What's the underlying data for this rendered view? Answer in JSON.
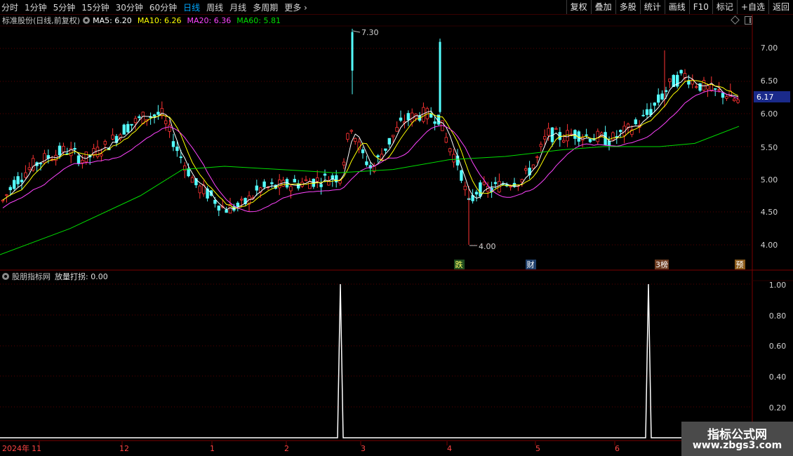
{
  "toolbar": {
    "left_items": [
      "分时",
      "1分钟",
      "5分钟",
      "15分钟",
      "30分钟",
      "60分钟",
      "日线",
      "周线",
      "月线",
      "多周期",
      "更多"
    ],
    "active": "日线",
    "right_items": [
      "复权",
      "叠加",
      "多股",
      "统计",
      "画线",
      "F10",
      "标记",
      "+自选",
      "返回"
    ]
  },
  "main_header": {
    "title": "标准股份(日线,前复权)",
    "ma": [
      {
        "label": "MA5: 6.20",
        "color": "#ffffff"
      },
      {
        "label": "MA10: 6.26",
        "color": "#ffff00"
      },
      {
        "label": "MA20: 6.36",
        "color": "#ff44ff"
      },
      {
        "label": "MA60: 5.81",
        "color": "#00dd00"
      }
    ]
  },
  "price_axis": {
    "labels": [
      "7.00",
      "6.50",
      "6.00",
      "5.50",
      "5.00",
      "4.50",
      "4.00"
    ],
    "current": "6.17"
  },
  "annotations": {
    "high": "7.30",
    "low": "4.00"
  },
  "event_markers": [
    {
      "label": "跌",
      "bg": "#1f4d1f",
      "color": "#ffff66"
    },
    {
      "label": "财",
      "bg": "#1f3f6b",
      "color": "#ffffff"
    },
    {
      "label": "3榜",
      "bg": "#6b3a1f",
      "color": "#ffffff"
    },
    {
      "label": "预",
      "bg": "#8a5a1a",
      "color": "#ffffff"
    }
  ],
  "sub_header": {
    "title": "股朋指标网",
    "indicator": "放量打拐: 0.00"
  },
  "indicator_axis": {
    "labels": [
      "1.00",
      "0.80",
      "0.60",
      "0.40",
      "0.20"
    ]
  },
  "timeline": {
    "labels": [
      "2024年",
      "11",
      "12",
      "1",
      "2",
      "3",
      "4",
      "5",
      "6"
    ]
  },
  "watermark": {
    "line1": "指标公式网",
    "line2": "www.zbgs3.com"
  },
  "colors": {
    "up": "#ff3333",
    "down": "#54ffff",
    "grid": "#5a0000",
    "axis": "#7a0000",
    "ma5": "#ffffff",
    "ma10": "#ffff00",
    "ma20": "#ff44ff",
    "ma60": "#00dd00"
  }
}
